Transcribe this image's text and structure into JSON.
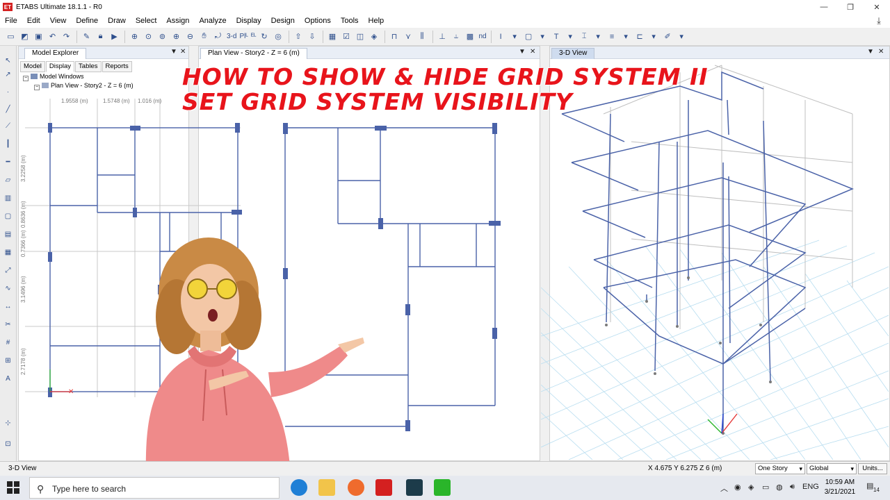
{
  "window": {
    "app_icon": "ET",
    "title": "ETABS Ultimate 18.1.1 - R0"
  },
  "menu": [
    "File",
    "Edit",
    "View",
    "Define",
    "Draw",
    "Select",
    "Assign",
    "Analyze",
    "Display",
    "Design",
    "Options",
    "Tools",
    "Help"
  ],
  "toolbar": {
    "view_3d": "3-d",
    "plan_label": "Plᴸ",
    "elev_label": "ᴱᴸ",
    "nd_label": "nd"
  },
  "explorer": {
    "title": "Model Explorer",
    "tabs": [
      "Model",
      "Display",
      "Tables",
      "Reports"
    ],
    "active_tab": "Display",
    "tree": [
      "Model Windows",
      "Plan View - Story2 - Z = 6 (m)"
    ]
  },
  "plan_view": {
    "title": "Plan View - Story2 - Z = 6 (m)",
    "top_dims": [
      "1.9558 (m)",
      "1.5748 (m)",
      "1.016 (m)"
    ],
    "side_dims": [
      "3.2258 (m)",
      "0.7366 (m)",
      "0.8636 (m)",
      "3.1496 (m)",
      "2.7178 (m)"
    ]
  },
  "view_3d": {
    "title": "3-D View"
  },
  "overlay": {
    "line1": "HOW TO SHOW & HIDE GRID SYSTEM II",
    "line2": "SET GRID SYSTEM VISIBILITY"
  },
  "status": {
    "left": "3-D View",
    "coords": "X 4.675  Y 6.275  Z 6 (m)",
    "story_select": "One Story",
    "coord_select": "Global",
    "units_button": "Units..."
  },
  "taskbar": {
    "search_placeholder": "Type here to search",
    "language": "ENG",
    "time": "10:59 AM",
    "date": "3/21/2021",
    "notification_count": "14"
  },
  "colors": {
    "frame_blue": "#4a62a8",
    "heading_red": "#e8141b",
    "hoodie": "#ef8a8a"
  }
}
